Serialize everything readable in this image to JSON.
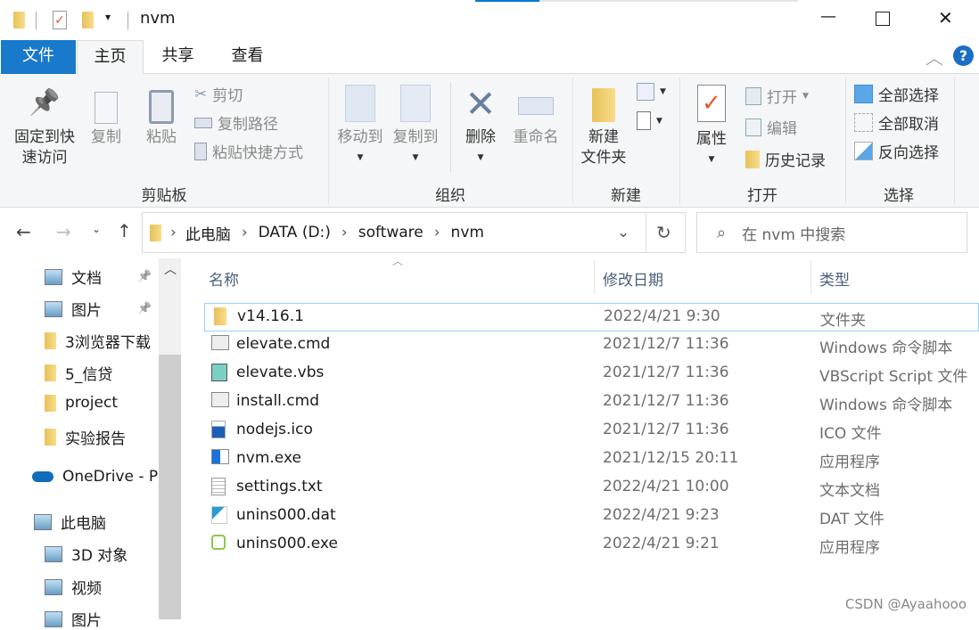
{
  "window": {
    "title": "nvm",
    "minimize": "—",
    "close": "✕"
  },
  "tabs": [
    {
      "label": "文件",
      "active": false
    },
    {
      "label": "主页",
      "active": true
    },
    {
      "label": "共享"
    },
    {
      "label": "查看"
    }
  ],
  "ribbon": {
    "clipboard": {
      "label": "剪贴板",
      "pin1": "固定到快",
      "pin2": "速访问",
      "copy": "复制",
      "paste": "粘贴",
      "cut": "剪切",
      "copy_path": "复制路径",
      "paste_shortcut": "粘贴快捷方式"
    },
    "organize": {
      "label": "组织",
      "move_to": "移动到",
      "copy_to": "复制到",
      "delete": "删除",
      "rename": "重命名"
    },
    "new": {
      "label": "新建",
      "new_folder1": "新建",
      "new_folder2": "文件夹"
    },
    "open": {
      "label": "打开",
      "properties": "属性",
      "open": "打开",
      "edit": "编辑",
      "history": "历史记录"
    },
    "select": {
      "label": "选择",
      "select_all": "全部选择",
      "select_none": "全部取消",
      "invert": "反向选择"
    }
  },
  "address": {
    "breadcrumb": [
      "此电脑",
      "DATA (D:)",
      "software",
      "nvm"
    ],
    "search_placeholder": "在 nvm 中搜索"
  },
  "nav": [
    {
      "label": "文档",
      "pinned": true
    },
    {
      "label": "图片",
      "pinned": true
    },
    {
      "label": "3浏览器下载"
    },
    {
      "label": "5_信贷"
    },
    {
      "label": "project"
    },
    {
      "label": "实验报告"
    },
    {
      "label": "OneDrive - P"
    },
    {
      "label": "此电脑"
    },
    {
      "label": "3D 对象"
    },
    {
      "label": "视频"
    },
    {
      "label": "图片"
    }
  ],
  "columns": {
    "name": "名称",
    "date": "修改日期",
    "type": "类型"
  },
  "files": [
    {
      "name": "v14.16.1",
      "date": "2022/4/21 9:30",
      "type": "文件夹",
      "icon": "folder-icon",
      "selected": true
    },
    {
      "name": "elevate.cmd",
      "date": "2021/12/7 11:36",
      "type": "Windows 命令脚本",
      "icon": "cmd-icon"
    },
    {
      "name": "elevate.vbs",
      "date": "2021/12/7 11:36",
      "type": "VBScript Script 文件",
      "icon": "vbs-icon"
    },
    {
      "name": "install.cmd",
      "date": "2021/12/7 11:36",
      "type": "Windows 命令脚本",
      "icon": "cmd-icon"
    },
    {
      "name": "nodejs.ico",
      "date": "2021/12/7 11:36",
      "type": "ICO 文件",
      "icon": "image-icon"
    },
    {
      "name": "nvm.exe",
      "date": "2021/12/15 20:11",
      "type": "应用程序",
      "icon": "exe-icon"
    },
    {
      "name": "settings.txt",
      "date": "2022/4/21 10:00",
      "type": "文本文档",
      "icon": "text-icon"
    },
    {
      "name": "unins000.dat",
      "date": "2022/4/21 9:23",
      "type": "DAT 文件",
      "icon": "media-icon"
    },
    {
      "name": "unins000.exe",
      "date": "2022/4/21 9:21",
      "type": "应用程序",
      "icon": "nodejs-icon"
    }
  ],
  "watermark": "CSDN @Ayaahooo",
  "colors": {
    "accent": "#0078d7",
    "selection_border": "#99d1ff"
  }
}
